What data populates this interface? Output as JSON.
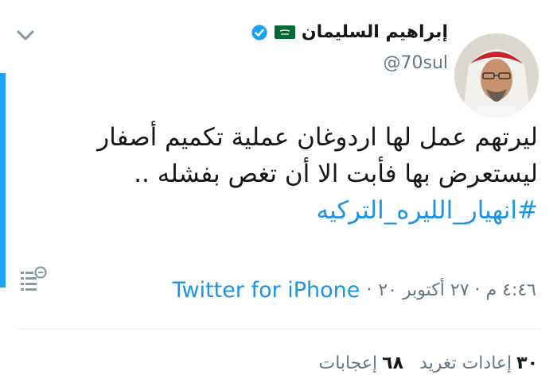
{
  "tweet": {
    "author": {
      "display_name": "إبراهيم السليمان",
      "handle": "@70sul",
      "flag_icon": "saudi-flag-icon",
      "verified_icon": "verified-badge-icon"
    },
    "text_lines": [
      "ليرتهم عمل لها اردوغان عملية تكميم أصفار",
      "ليستعرض بها فأبت الا أن تغص بفشله .."
    ],
    "hashtag": "#انهيار_الليره_التركيه",
    "timestamp": "٤:٤٦ م · ٢٧ أكتوبر ٢٠",
    "source": "Twitter for iPhone",
    "retweets": {
      "count": "٣٠",
      "label": "إعادات تغريد"
    },
    "likes": {
      "count": "٦٨",
      "label": "إعجابات"
    }
  },
  "colors": {
    "accent": "#1da1f2",
    "link": "#1b95e0",
    "muted": "#657786",
    "flag_green": "#006c35"
  }
}
